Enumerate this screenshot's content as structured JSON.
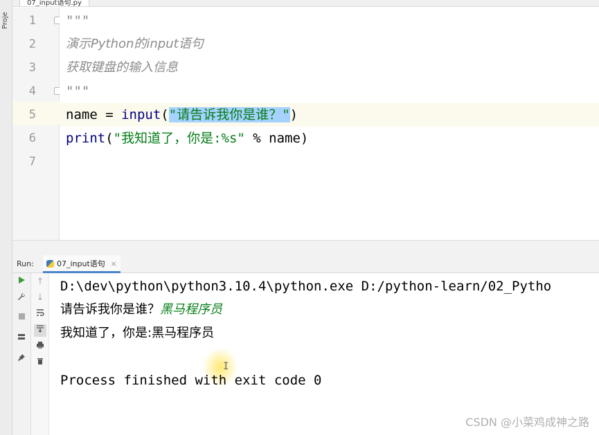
{
  "sidebar": {
    "project_label": "Proje"
  },
  "editor": {
    "tab_label": "07_input语句.py",
    "line_numbers": [
      "1",
      "2",
      "3",
      "4",
      "5",
      "6",
      "7"
    ],
    "lines": {
      "l1": "\"\"\"",
      "l2": "演示Python的input语句",
      "l3": "获取键盘的输入信息",
      "l4": "\"\"\"",
      "l5_var": "name",
      "l5_eq": " = ",
      "l5_fn": "input",
      "l5_open": "(",
      "l5_str": "\"请告诉我你是谁？\"",
      "l5_close": ")",
      "l6_fn": "print",
      "l6_open": "(",
      "l6_str": "\"我知道了，你是:%s\"",
      "l6_rest": " % name)"
    }
  },
  "run": {
    "label": "Run:",
    "tab_label": "07_input语句",
    "close_glyph": "×",
    "icons": [
      "play-icon",
      "wrench-icon",
      "stop-icon",
      "layout-icon",
      "pin-icon",
      "arrow-up-icon",
      "arrow-down-icon",
      "soft-wrap-icon",
      "scroll-to-end-icon",
      "print-icon",
      "trash-icon"
    ]
  },
  "console": {
    "command": "D:\\dev\\python\\python3.10.4\\python.exe D:/python-learn/02_Pytho",
    "prompt": "请告诉我你是谁？",
    "user_input": "黑马程序员",
    "output": "我知道了，你是:黑马程序员",
    "finished": "Process finished with exit code 0"
  },
  "watermark": "CSDN @小菜鸡成神之路",
  "colors": {
    "string": "#067d17",
    "selection": "#a6d2ff",
    "docstring": "#8c8c8c",
    "function": "#000080",
    "caret_row": "#fcfaed"
  }
}
